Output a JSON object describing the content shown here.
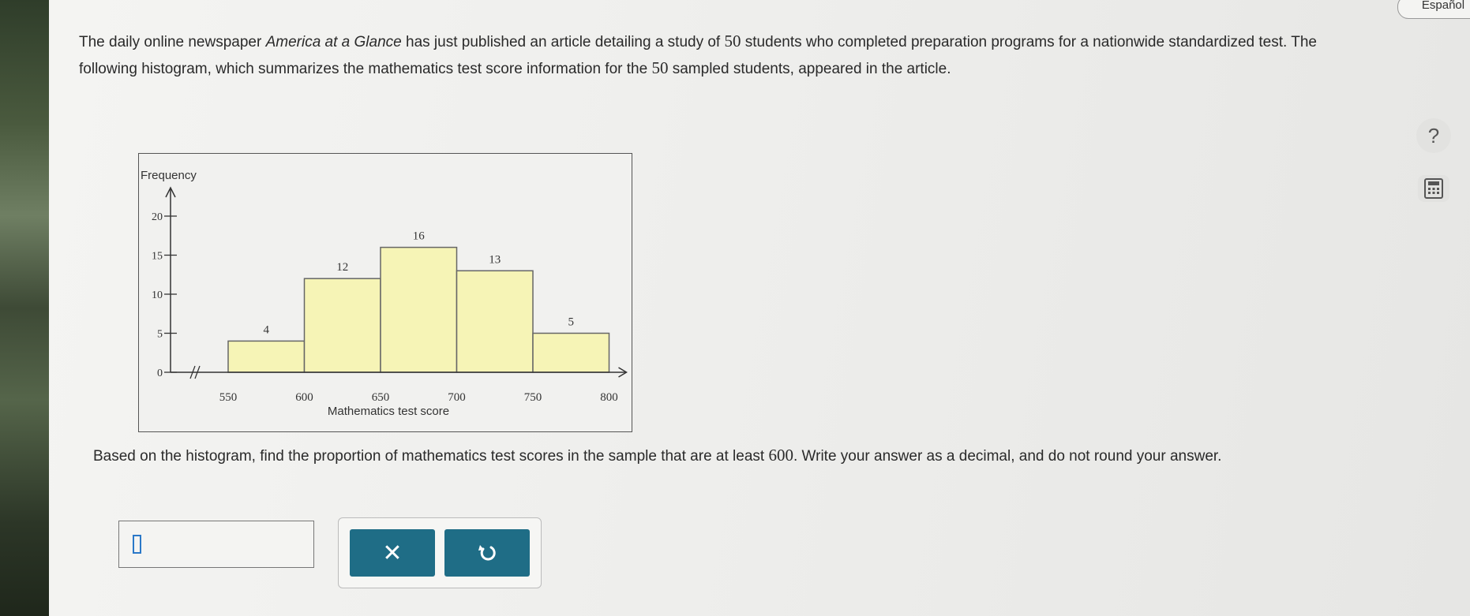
{
  "header": {
    "language_button": "Español",
    "help_label": "?"
  },
  "problem": {
    "part1": "The daily online newspaper ",
    "newspaper": "America at a Glance",
    "part2": " has just published an article detailing a study of ",
    "n1": "50",
    "part3": " students who completed preparation programs for a nationwide standardized test. The following histogram, which summarizes the mathematics test score information for the ",
    "n2": "50",
    "part4": " sampled students, appeared in the article."
  },
  "question": {
    "part1": "Based on the histogram, find the proportion of mathematics test scores in the sample that are at least ",
    "value": "600",
    "part2": ". Write your answer as a decimal, and do not round your answer."
  },
  "answer": {
    "value": ""
  },
  "buttons": {
    "clear_label": "✕"
  },
  "icons": {
    "calculator": "calculator-icon",
    "undo": "undo-icon",
    "help": "help-icon"
  },
  "colors": {
    "bar_fill": "#f6f4b6",
    "bar_stroke": "#666666",
    "button": "#1f6d86"
  },
  "chart_data": {
    "type": "bar",
    "ylabel": "Frequency",
    "xlabel": "Mathematics test score",
    "bins": [
      [
        550,
        600
      ],
      [
        600,
        650
      ],
      [
        650,
        700
      ],
      [
        700,
        750
      ],
      [
        750,
        800
      ]
    ],
    "values": [
      4,
      12,
      16,
      13,
      5
    ],
    "x_ticks": [
      "550",
      "600",
      "650",
      "700",
      "750",
      "800"
    ],
    "y_ticks": [
      "0",
      "5",
      "10",
      "15",
      "20"
    ],
    "ylim": [
      0,
      20
    ],
    "axis_break": true,
    "grid": false
  }
}
